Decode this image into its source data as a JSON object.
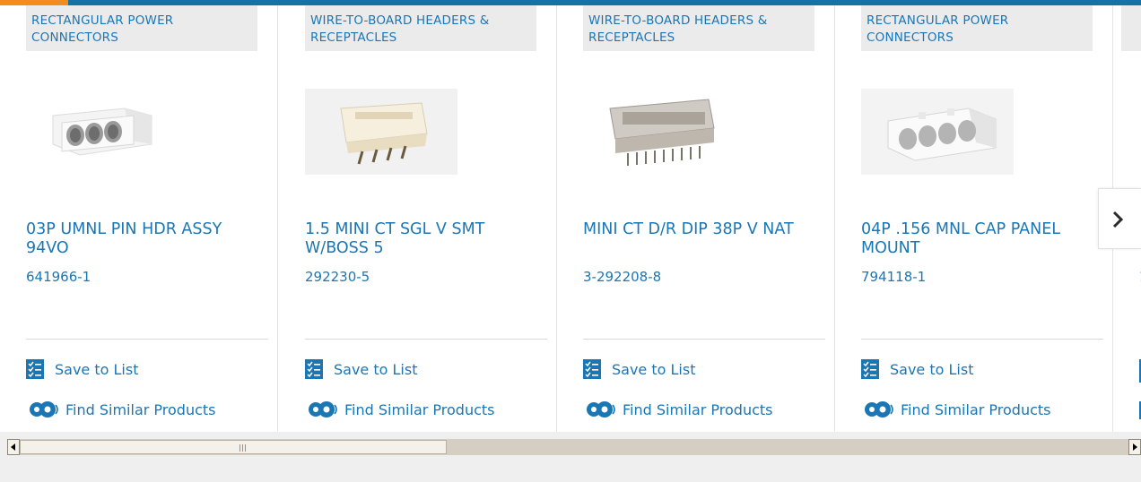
{
  "colors": {
    "brand_blue": "#1b76b4",
    "accent_orange": "#f28c1e",
    "category_bg": "#ebebeb"
  },
  "products": [
    {
      "category": "RECTANGULAR POWER CONNECTORS",
      "title": "03P UMNL PIN HDR ASSY 94VO",
      "part_number": "641966-1",
      "image": "white-3-pin-header"
    },
    {
      "category": "WIRE-TO-BOARD HEADERS & RECEPTACLES",
      "title": "1.5 MINI CT SGL V SMT W/BOSS 5",
      "part_number": "292230-5",
      "image": "beige-smt-header"
    },
    {
      "category": "WIRE-TO-BOARD HEADERS & RECEPTACLES",
      "title": "MINI CT D/R DIP 38P V NAT",
      "part_number": "3-292208-8",
      "image": "grey-dual-row-header"
    },
    {
      "category": "RECTANGULAR POWER CONNECTORS",
      "title": "04P .156 MNL CAP PANEL MOUNT",
      "part_number": "794118-1",
      "image": "white-4-pin-cap"
    },
    {
      "category": "",
      "title": "",
      "part_number": "1",
      "image": ""
    }
  ],
  "actions": {
    "save_label": "Save to List",
    "similar_label": "Find Similar Products"
  },
  "icons": {
    "save": "checklist-icon",
    "similar": "gears-icon",
    "next": "chevron-right-icon"
  }
}
